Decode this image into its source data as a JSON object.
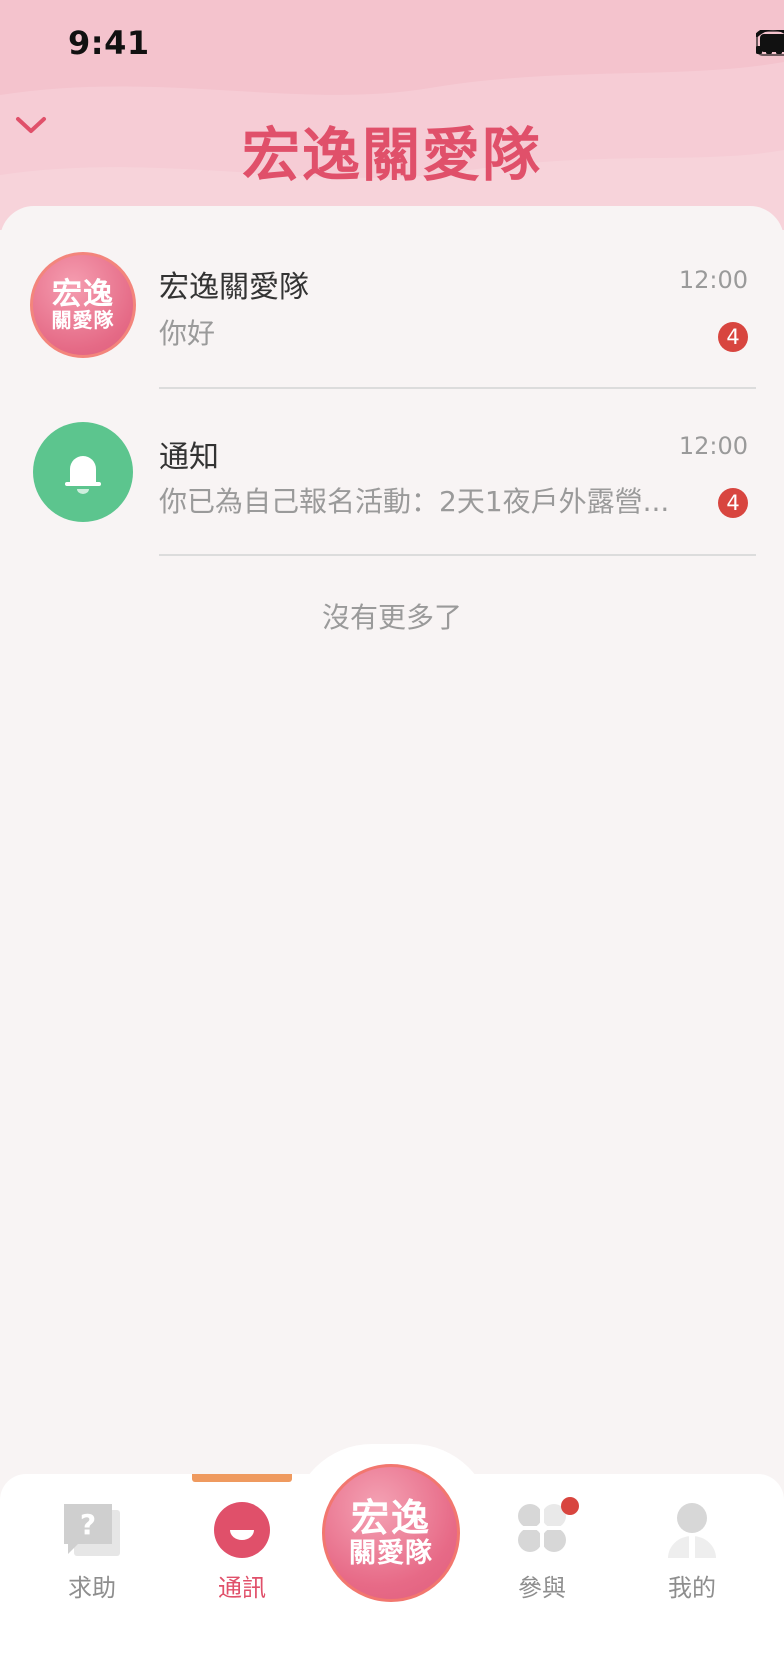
{
  "status_bar": {
    "time": "9:41"
  },
  "header": {
    "title": "宏逸關愛隊"
  },
  "conversations": [
    {
      "logo_line1": "宏逸",
      "logo_line2": "關愛隊",
      "title": "宏逸關愛隊",
      "preview": "你好",
      "time": "12:00",
      "unread": "4",
      "icon": "team-logo"
    },
    {
      "title": "通知",
      "preview": "你已為自己報名活動：2天1夜戶外露營...",
      "time": "12:00",
      "unread": "4",
      "icon": "bell-icon"
    }
  ],
  "list_footer": "沒有更多了",
  "tabbar": {
    "help": "求助",
    "messages": "通訊",
    "center_line1": "宏逸",
    "center_line2": "關愛隊",
    "participate": "參與",
    "mine": "我的",
    "active": "通訊"
  },
  "colors": {
    "accent": "#e0506a",
    "header_bg": "#f4c3cd",
    "badge": "#d8453f",
    "bell_bg": "#5cc58e",
    "indicator": "#ef9a5f"
  }
}
